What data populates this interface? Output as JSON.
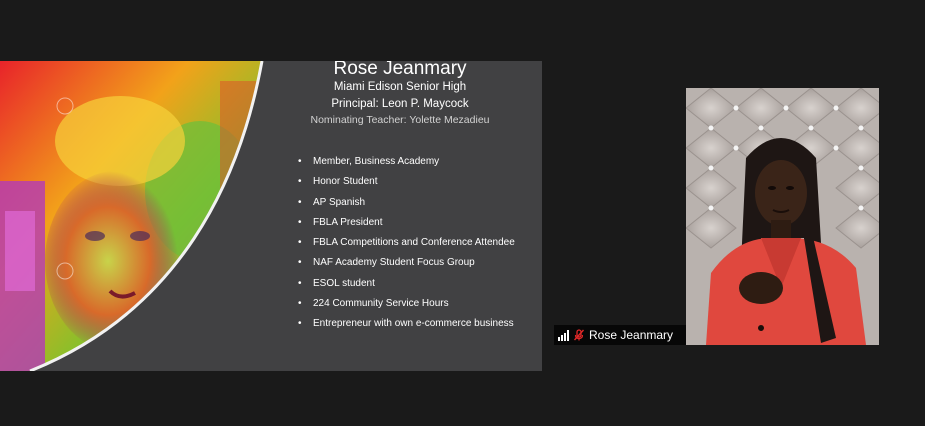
{
  "slide": {
    "title": "Rose Jeanmary",
    "school": "Miami Edison Senior High",
    "principal": "Principal:  Leon P. Maycock",
    "nominating_teacher": "Nominating Teacher: Yolette Mezadieu",
    "bullets": [
      "Member, Business Academy",
      "Honor Student",
      "AP Spanish",
      "FBLA President",
      "FBLA Competitions and Conference Attendee",
      "NAF Academy Student Focus Group",
      "ESOL student",
      "224 Community Service Hours",
      "Entrepreneur with own e-commerce business"
    ]
  },
  "participant": {
    "name": "Rose Jeanmary",
    "signal_icon": "signal-bars-icon",
    "mic_icon": "mic-muted-icon",
    "muted_color": "#e02828"
  }
}
